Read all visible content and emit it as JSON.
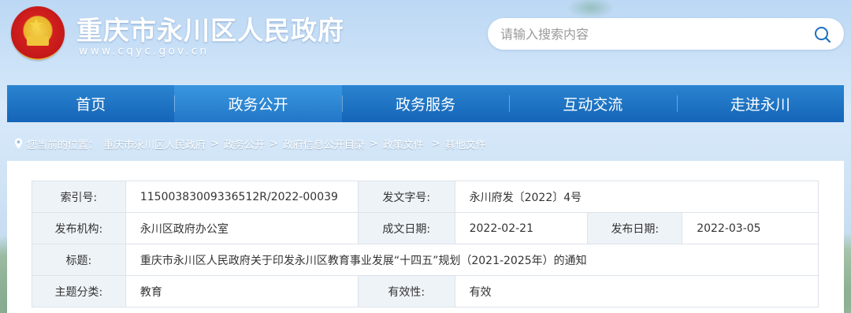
{
  "header": {
    "site_title": "重庆市永川区人民政府",
    "site_url": "www.cqyc.gov.cn",
    "search_placeholder": "请输入搜索内容"
  },
  "nav": {
    "items": [
      {
        "label": "首页"
      },
      {
        "label": "政务公开",
        "active": true
      },
      {
        "label": "政务服务"
      },
      {
        "label": "互动交流"
      },
      {
        "label": "走进永川"
      }
    ]
  },
  "breadcrumb": {
    "prefix": "您当前的位置：",
    "items": [
      "重庆市永川区人民政府",
      "政务公开",
      "政府信息公开目录",
      "政策文件",
      "其他文件"
    ],
    "separator": ">"
  },
  "meta": {
    "index_label": "索引号:",
    "index_value": "11500383009336512R/2022-00039",
    "doc_no_label": "发文字号:",
    "doc_no_value": "永川府发〔2022〕4号",
    "issuer_label": "发布机构:",
    "issuer_value": "永川区政府办公室",
    "created_label": "成文日期:",
    "created_value": "2022-02-21",
    "published_label": "发布日期:",
    "published_value": "2022-03-05",
    "title_label": "标题:",
    "title_value": "重庆市永川区人民政府关于印发永川区教育事业发展“十四五”规划（2021-2025年）的通知",
    "topic_label": "主题分类:",
    "topic_value": "教育",
    "validity_label": "有效性:",
    "validity_value": "有效"
  },
  "colors": {
    "nav_bg": "#1565b8",
    "nav_active": "#2f8ad6",
    "label_cell_bg": "#eef3f8"
  }
}
